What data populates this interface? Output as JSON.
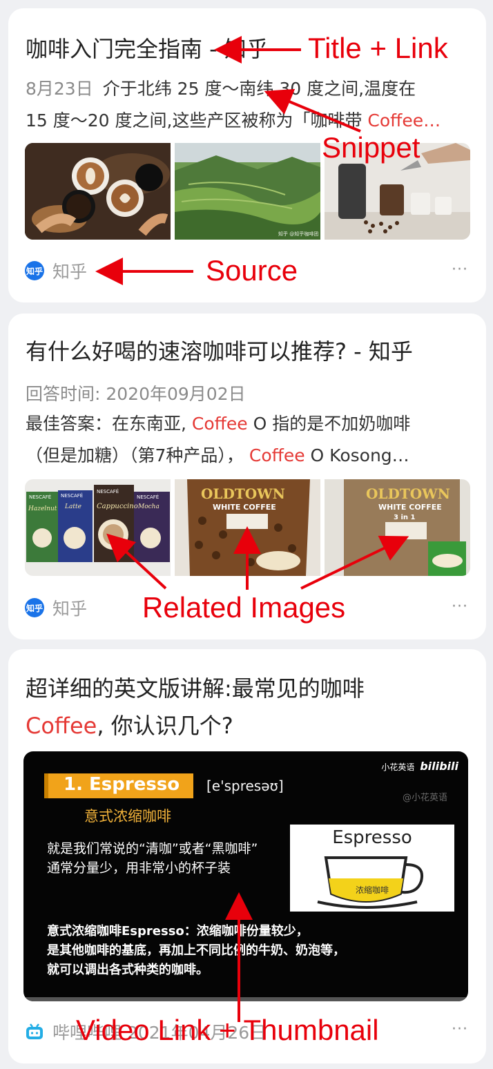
{
  "colors": {
    "keyword": "#e53935",
    "annotation": "#e8000b",
    "background": "#eff0f3",
    "card": "#ffffff"
  },
  "results": [
    {
      "title": "咖啡入门完全指南 - 知乎",
      "date": "8月23日",
      "snippet_line1": "介于北纬 25 度～南纬 30 度之间,温度在",
      "snippet_line2": "15 度～20 度之间,这些产区被称为「咖啡带 ",
      "snippet_kw": "Coffee…",
      "images": [
        "coffee-cups-photo",
        "mountain-terrace-photo",
        "pour-over-coffee-photo"
      ],
      "image_watermark": "知乎 @知乎咖啡团",
      "source_icon": "zhihu-logo",
      "source_icon_text": "知乎",
      "source": "知乎",
      "more": "···"
    },
    {
      "title": "有什么好喝的速溶咖啡可以推荐? - 知乎",
      "date": "回答时间: 2020年09月02日",
      "snippet_pre": "最佳答案：在东南亚, ",
      "snippet_kw": "Coffee",
      "snippet_post": " O 指的是不加奶咖啡",
      "snippet2_pre": "（但是加糖）（第7种产品）， ",
      "snippet2_kw": "Coffee",
      "snippet2_post": " O Kosong…",
      "images": [
        "nescafe-packs-photo",
        "oldtown-white-coffee-photo",
        "oldtown-3in1-photo"
      ],
      "image_labels": {
        "nescafe": "NESCAFÉ",
        "latte": "Latte",
        "cappuccino": "Cappuccino",
        "mocha": "Mocha",
        "hazelnut": "Hazelnut",
        "oldtown": "OLDTOWN",
        "white_coffee": "WHITE COFFEE",
        "three_in_one": "3 in 1"
      },
      "source_icon": "zhihu-logo",
      "source_icon_text": "知乎",
      "source": "知乎",
      "more": "···"
    },
    {
      "title_line1": "超详细的英文版讲解:最常见的咖啡",
      "title_kw": "Coffee",
      "title_line2_rest": ", 你认识几个?",
      "video": {
        "tag": "1. Espresso",
        "phonetic": "[e'spresəʊ]",
        "cn_name": "意式浓缩咖啡",
        "brand": "小花英语",
        "platform": "bilibili",
        "handle": "@小花英语",
        "desc1": "就是我们常说的“清咖”或者“黑咖啡”",
        "desc2": "通常分量少，用非常小的杯子装",
        "cup_label": "Espresso",
        "cup_sub": "浓缩咖啡",
        "sub1": "意式浓缩咖啡Espresso：浓缩咖啡份量较少，",
        "sub2": "是其他咖啡的基底，再加上不同比例的牛奶、奶泡等，",
        "sub3": "就可以调出各式种类的咖啡。"
      },
      "source_icon": "bilibili-icon",
      "source": "哔哩哔哩 2021年04月26日",
      "more": "···"
    }
  ],
  "annotations": {
    "title_link": "Title + Link",
    "snippet": "Snippet",
    "source": "Source",
    "related_images": "Related Images",
    "video": "Video Link + Thumbnail"
  }
}
